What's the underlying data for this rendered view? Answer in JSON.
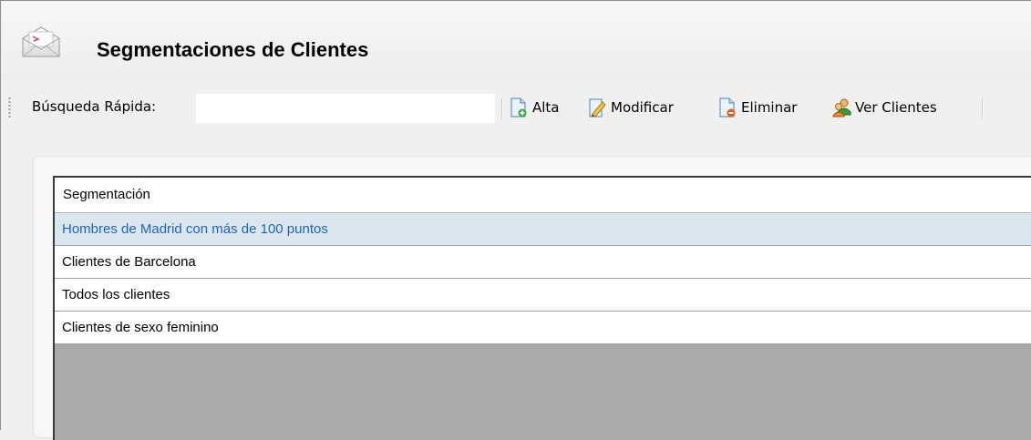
{
  "header": {
    "title": "Segmentaciones de Clientes",
    "icon": "envelope-icon"
  },
  "toolbar": {
    "search_label": "Búsqueda Rápida:",
    "search_value": "",
    "buttons": [
      {
        "label": "Alta",
        "icon": "document-add-icon"
      },
      {
        "label": "Modificar",
        "icon": "edit-icon"
      },
      {
        "label": "Eliminar",
        "icon": "document-delete-icon"
      },
      {
        "label": "Ver Clientes",
        "icon": "users-icon"
      }
    ]
  },
  "grid": {
    "columns": [
      "Segmentación"
    ],
    "rows": [
      "Hombres de Madrid con más de 100 puntos",
      "Clientes de Barcelona",
      "Todos los clientes",
      "Clientes de sexo feminino"
    ],
    "selected_row": 0
  },
  "colors": {
    "selection_bg": "#dbe6f1",
    "selection_text": "#1e65b8",
    "grid_empty_bg": "#a9a9a9"
  }
}
